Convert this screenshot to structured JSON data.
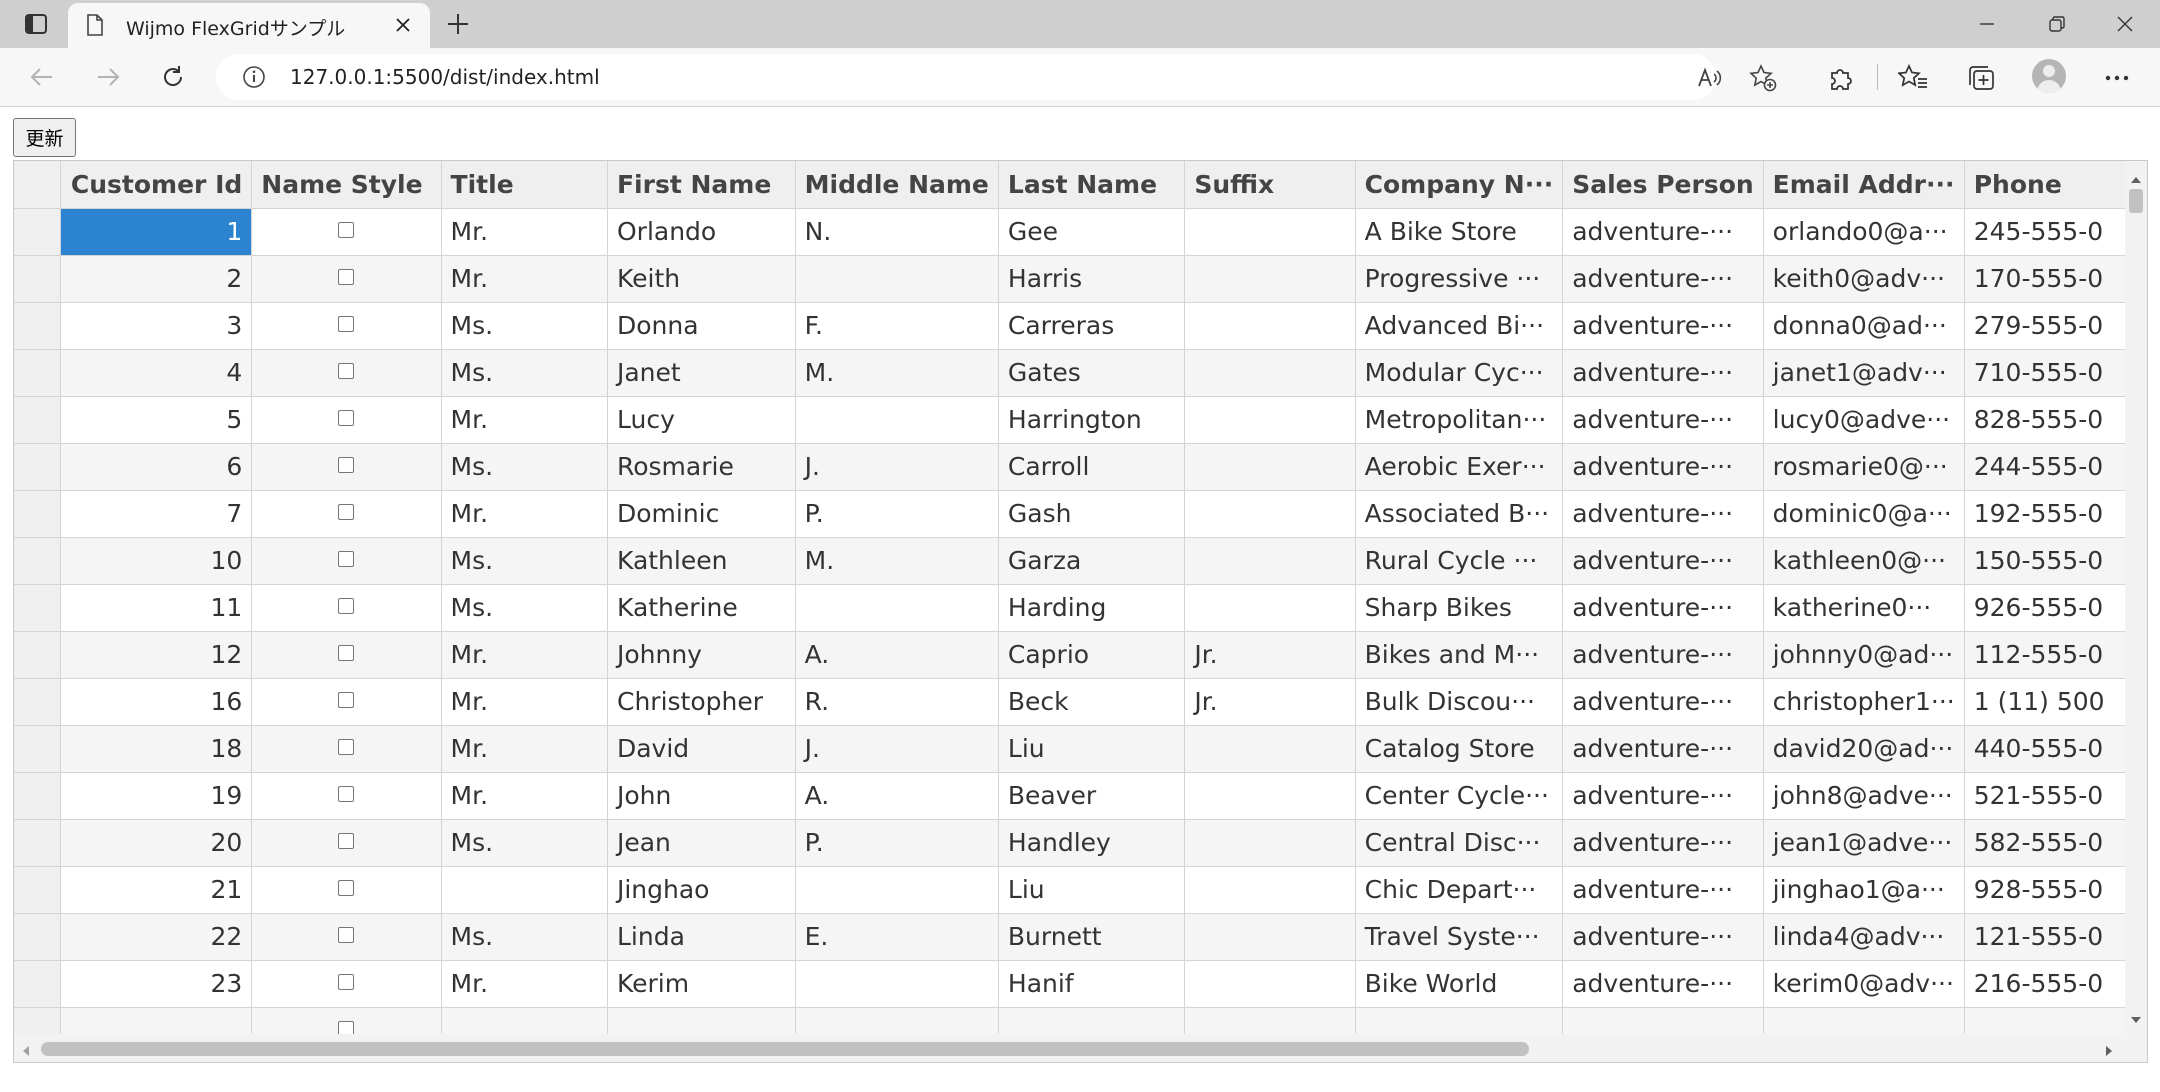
{
  "browser": {
    "tab_title": "Wijmo FlexGridサンプル",
    "url": "127.0.0.1:5500/dist/index.html"
  },
  "page": {
    "update_button": "更新"
  },
  "grid": {
    "columns": [
      "Customer Id",
      "Name Style",
      "Title",
      "First Name",
      "Middle Name",
      "Last Name",
      "Suffix",
      "Company N···",
      "Sales Person",
      "Email Addr···",
      "Phone"
    ],
    "rows": [
      {
        "id": "1",
        "title": "Mr.",
        "first": "Orlando",
        "middle": "N.",
        "last": "Gee",
        "suffix": "",
        "company": "A Bike Store",
        "sales": "adventure-···",
        "email": "orlando0@a···",
        "phone": "245-555-0"
      },
      {
        "id": "2",
        "title": "Mr.",
        "first": "Keith",
        "middle": "",
        "last": "Harris",
        "suffix": "",
        "company": "Progressive ···",
        "sales": "adventure-···",
        "email": "keith0@adv···",
        "phone": "170-555-0"
      },
      {
        "id": "3",
        "title": "Ms.",
        "first": "Donna",
        "middle": "F.",
        "last": "Carreras",
        "suffix": "",
        "company": "Advanced Bi···",
        "sales": "adventure-···",
        "email": "donna0@ad···",
        "phone": "279-555-0"
      },
      {
        "id": "4",
        "title": "Ms.",
        "first": "Janet",
        "middle": "M.",
        "last": "Gates",
        "suffix": "",
        "company": "Modular Cyc···",
        "sales": "adventure-···",
        "email": "janet1@adv···",
        "phone": "710-555-0"
      },
      {
        "id": "5",
        "title": "Mr.",
        "first": "Lucy",
        "middle": "",
        "last": "Harrington",
        "suffix": "",
        "company": "Metropolitan···",
        "sales": "adventure-···",
        "email": "lucy0@adve···",
        "phone": "828-555-0"
      },
      {
        "id": "6",
        "title": "Ms.",
        "first": "Rosmarie",
        "middle": "J.",
        "last": "Carroll",
        "suffix": "",
        "company": "Aerobic Exer···",
        "sales": "adventure-···",
        "email": "rosmarie0@···",
        "phone": "244-555-0"
      },
      {
        "id": "7",
        "title": "Mr.",
        "first": "Dominic",
        "middle": "P.",
        "last": "Gash",
        "suffix": "",
        "company": "Associated B···",
        "sales": "adventure-···",
        "email": "dominic0@a···",
        "phone": "192-555-0"
      },
      {
        "id": "10",
        "title": "Ms.",
        "first": "Kathleen",
        "middle": "M.",
        "last": "Garza",
        "suffix": "",
        "company": "Rural Cycle ···",
        "sales": "adventure-···",
        "email": "kathleen0@···",
        "phone": "150-555-0"
      },
      {
        "id": "11",
        "title": "Ms.",
        "first": "Katherine",
        "middle": "",
        "last": "Harding",
        "suffix": "",
        "company": "Sharp Bikes",
        "sales": "adventure-···",
        "email": "katherine0···",
        "phone": "926-555-0"
      },
      {
        "id": "12",
        "title": "Mr.",
        "first": "Johnny",
        "middle": "A.",
        "last": "Caprio",
        "suffix": "Jr.",
        "company": "Bikes and M···",
        "sales": "adventure-···",
        "email": "johnny0@ad···",
        "phone": "112-555-0"
      },
      {
        "id": "16",
        "title": "Mr.",
        "first": "Christopher",
        "middle": "R.",
        "last": "Beck",
        "suffix": "Jr.",
        "company": "Bulk Discou···",
        "sales": "adventure-···",
        "email": "christopher1···",
        "phone": "1 (11) 500"
      },
      {
        "id": "18",
        "title": "Mr.",
        "first": "David",
        "middle": "J.",
        "last": "Liu",
        "suffix": "",
        "company": "Catalog Store",
        "sales": "adventure-···",
        "email": "david20@ad···",
        "phone": "440-555-0"
      },
      {
        "id": "19",
        "title": "Mr.",
        "first": "John",
        "middle": "A.",
        "last": "Beaver",
        "suffix": "",
        "company": "Center Cycle···",
        "sales": "adventure-···",
        "email": "john8@adve···",
        "phone": "521-555-0"
      },
      {
        "id": "20",
        "title": "Ms.",
        "first": "Jean",
        "middle": "P.",
        "last": "Handley",
        "suffix": "",
        "company": "Central Disc···",
        "sales": "adventure-···",
        "email": "jean1@adve···",
        "phone": "582-555-0"
      },
      {
        "id": "21",
        "title": "",
        "first": "Jinghao",
        "middle": "",
        "last": "Liu",
        "suffix": "",
        "company": "Chic Depart···",
        "sales": "adventure-···",
        "email": "jinghao1@a···",
        "phone": "928-555-0"
      },
      {
        "id": "22",
        "title": "Ms.",
        "first": "Linda",
        "middle": "E.",
        "last": "Burnett",
        "suffix": "",
        "company": "Travel Syste···",
        "sales": "adventure-···",
        "email": "linda4@adv···",
        "phone": "121-555-0"
      },
      {
        "id": "23",
        "title": "Mr.",
        "first": "Kerim",
        "middle": "",
        "last": "Hanif",
        "suffix": "",
        "company": "Bike World",
        "sales": "adventure-···",
        "email": "kerim0@adv···",
        "phone": "216-555-0"
      }
    ]
  },
  "colors": {
    "selected_cell": "#2c83d0",
    "header_bg": "#efefef",
    "alt_row_bg": "#f5f5f5"
  }
}
